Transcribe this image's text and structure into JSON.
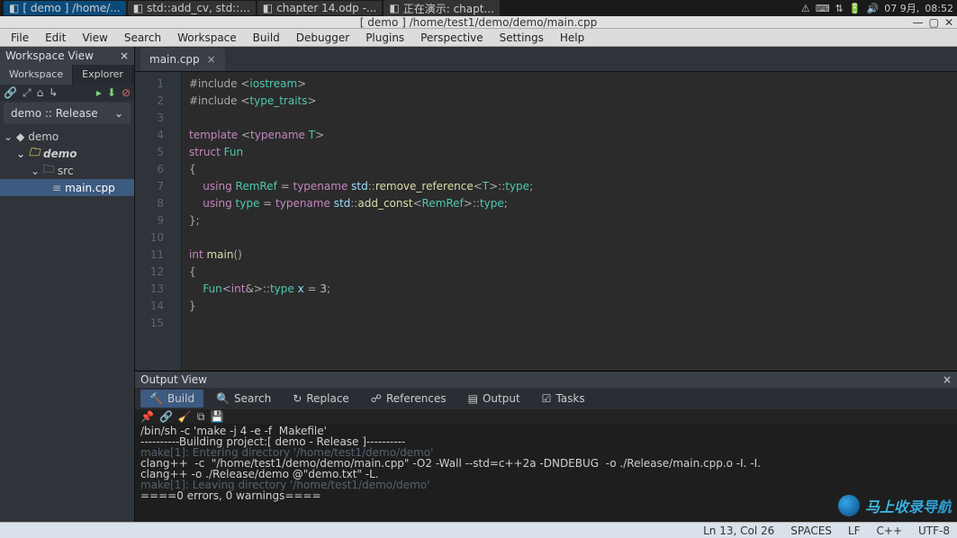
{
  "os": {
    "apps": [
      {
        "label": "[ demo ] /home/...",
        "active": true
      },
      {
        "label": "std::add_cv, std::..."
      },
      {
        "label": "chapter 14.odp -..."
      },
      {
        "label": "正在演示: chapt..."
      }
    ],
    "tray": {
      "date": "07 9月,",
      "time": "08:52"
    }
  },
  "window": {
    "title": "[ demo ] /home/test1/demo/demo/main.cpp"
  },
  "menu": [
    "File",
    "Edit",
    "View",
    "Search",
    "Workspace",
    "Build",
    "Debugger",
    "Plugins",
    "Perspective",
    "Settings",
    "Help"
  ],
  "workspace": {
    "panel_title": "Workspace View",
    "tabs": [
      "Workspace",
      "Explorer"
    ],
    "active_tab": 0,
    "config": "demo :: Release",
    "tree": {
      "root": "demo",
      "project": "demo",
      "src_folder": "src",
      "file": "main.cpp"
    }
  },
  "editor": {
    "tabs": [
      {
        "name": "main.cpp"
      }
    ],
    "code": [
      {
        "n": 1,
        "tokens": [
          [
            "pun",
            "#include "
          ],
          [
            "pun",
            "<"
          ],
          [
            "type",
            "iostream"
          ],
          [
            "pun",
            ">"
          ]
        ]
      },
      {
        "n": 2,
        "tokens": [
          [
            "pun",
            "#include "
          ],
          [
            "pun",
            "<"
          ],
          [
            "type",
            "type_traits"
          ],
          [
            "pun",
            ">"
          ]
        ]
      },
      {
        "n": 3,
        "tokens": []
      },
      {
        "n": 4,
        "tokens": [
          [
            "kw",
            "template"
          ],
          [
            "pun",
            " <"
          ],
          [
            "kw",
            "typename"
          ],
          [
            "pun",
            " "
          ],
          [
            "type",
            "T"
          ],
          [
            "pun",
            ">"
          ]
        ]
      },
      {
        "n": 5,
        "tokens": [
          [
            "kw",
            "struct"
          ],
          [
            "pun",
            " "
          ],
          [
            "type",
            "Fun"
          ]
        ]
      },
      {
        "n": 6,
        "tokens": [
          [
            "pun",
            "{"
          ]
        ]
      },
      {
        "n": 7,
        "tokens": [
          [
            "pun",
            "    "
          ],
          [
            "kw",
            "using"
          ],
          [
            "pun",
            " "
          ],
          [
            "type",
            "RemRef"
          ],
          [
            "pun",
            " = "
          ],
          [
            "kw",
            "typename"
          ],
          [
            "pun",
            " "
          ],
          [
            "ns",
            "std"
          ],
          [
            "pun",
            "::"
          ],
          [
            "fn",
            "remove_reference"
          ],
          [
            "pun",
            "<"
          ],
          [
            "type",
            "T"
          ],
          [
            "pun",
            ">::"
          ],
          [
            "type",
            "type"
          ],
          [
            "pun",
            ";"
          ]
        ]
      },
      {
        "n": 8,
        "tokens": [
          [
            "pun",
            "    "
          ],
          [
            "kw",
            "using"
          ],
          [
            "pun",
            " "
          ],
          [
            "type",
            "type"
          ],
          [
            "pun",
            " = "
          ],
          [
            "kw",
            "typename"
          ],
          [
            "pun",
            " "
          ],
          [
            "ns",
            "std"
          ],
          [
            "pun",
            "::"
          ],
          [
            "fn",
            "add_const"
          ],
          [
            "pun",
            "<"
          ],
          [
            "type",
            "RemRef"
          ],
          [
            "pun",
            ">::"
          ],
          [
            "type",
            "type"
          ],
          [
            "pun",
            ";"
          ]
        ]
      },
      {
        "n": 9,
        "tokens": [
          [
            "pun",
            "};"
          ]
        ]
      },
      {
        "n": 10,
        "tokens": []
      },
      {
        "n": 11,
        "tokens": [
          [
            "kw",
            "int"
          ],
          [
            "pun",
            " "
          ],
          [
            "fn",
            "main"
          ],
          [
            "pun",
            "()"
          ]
        ]
      },
      {
        "n": 12,
        "tokens": [
          [
            "pun",
            "{"
          ]
        ]
      },
      {
        "n": 13,
        "tokens": [
          [
            "pun",
            "    "
          ],
          [
            "type",
            "Fun"
          ],
          [
            "pun",
            "<"
          ],
          [
            "kw",
            "int"
          ],
          [
            "pun",
            "&>::"
          ],
          [
            "type",
            "type"
          ],
          [
            "pun",
            " "
          ],
          [
            "ns",
            "x"
          ],
          [
            "pun",
            " = "
          ],
          [
            "num",
            "3"
          ],
          [
            "pun",
            ";"
          ]
        ]
      },
      {
        "n": 14,
        "tokens": [
          [
            "pun",
            "}"
          ]
        ]
      },
      {
        "n": 15,
        "tokens": []
      }
    ]
  },
  "output": {
    "title": "Output View",
    "tabs": [
      "Build",
      "Search",
      "Replace",
      "References",
      "Output",
      "Tasks"
    ],
    "active_tab": 0,
    "lines": [
      {
        "cls": "hl",
        "text": "/bin/sh -c 'make -j 4 -e -f  Makefile'"
      },
      {
        "cls": "hl",
        "text": "----------Building project:[ demo - Release ]----------"
      },
      {
        "cls": "dim",
        "text": "make[1]: Entering directory '/home/test1/demo/demo'"
      },
      {
        "cls": "hl",
        "text": "clang++  -c  \"/home/test1/demo/demo/main.cpp\" -O2 -Wall --std=c++2a -DNDEBUG  -o ./Release/main.cpp.o -I. -I."
      },
      {
        "cls": "hl",
        "text": "clang++ -o ./Release/demo @\"demo.txt\" -L."
      },
      {
        "cls": "dim",
        "text": "make[1]: Leaving directory '/home/test1/demo/demo'"
      },
      {
        "cls": "hl",
        "text": "====0 errors, 0 warnings===="
      }
    ]
  },
  "status": {
    "pos": "Ln 13, Col 26",
    "spaces": "SPACES",
    "eol": "LF",
    "lang": "C++",
    "enc": "UTF-8"
  },
  "watermark": "马上收录导航"
}
